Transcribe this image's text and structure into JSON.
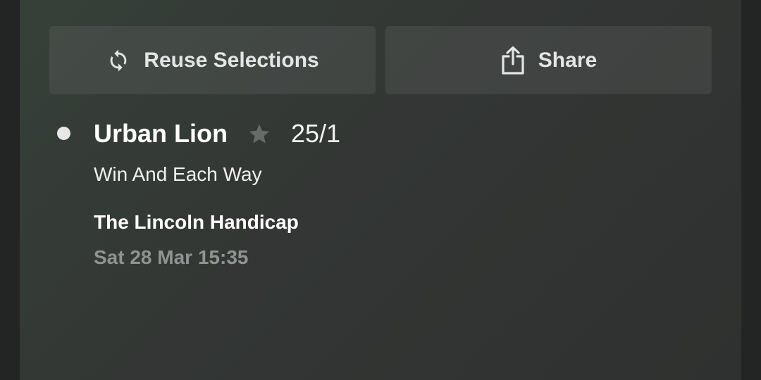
{
  "actions": {
    "reuse_label": "Reuse Selections",
    "share_label": "Share"
  },
  "selection": {
    "runner": "Urban Lion",
    "odds": "25/1",
    "market": "Win And Each Way",
    "event": "The Lincoln Handicap",
    "datetime": "Sat 28 Mar 15:35",
    "icons": {
      "reuse": "refresh-icon",
      "share": "share-icon",
      "favourite": "star-icon",
      "bullet": "bullet-dot"
    }
  },
  "colors": {
    "card_background": "#343836",
    "button_background": "#434845",
    "primary_text": "#ffffff",
    "secondary_text": "#8f9391",
    "star": "#666a68"
  }
}
